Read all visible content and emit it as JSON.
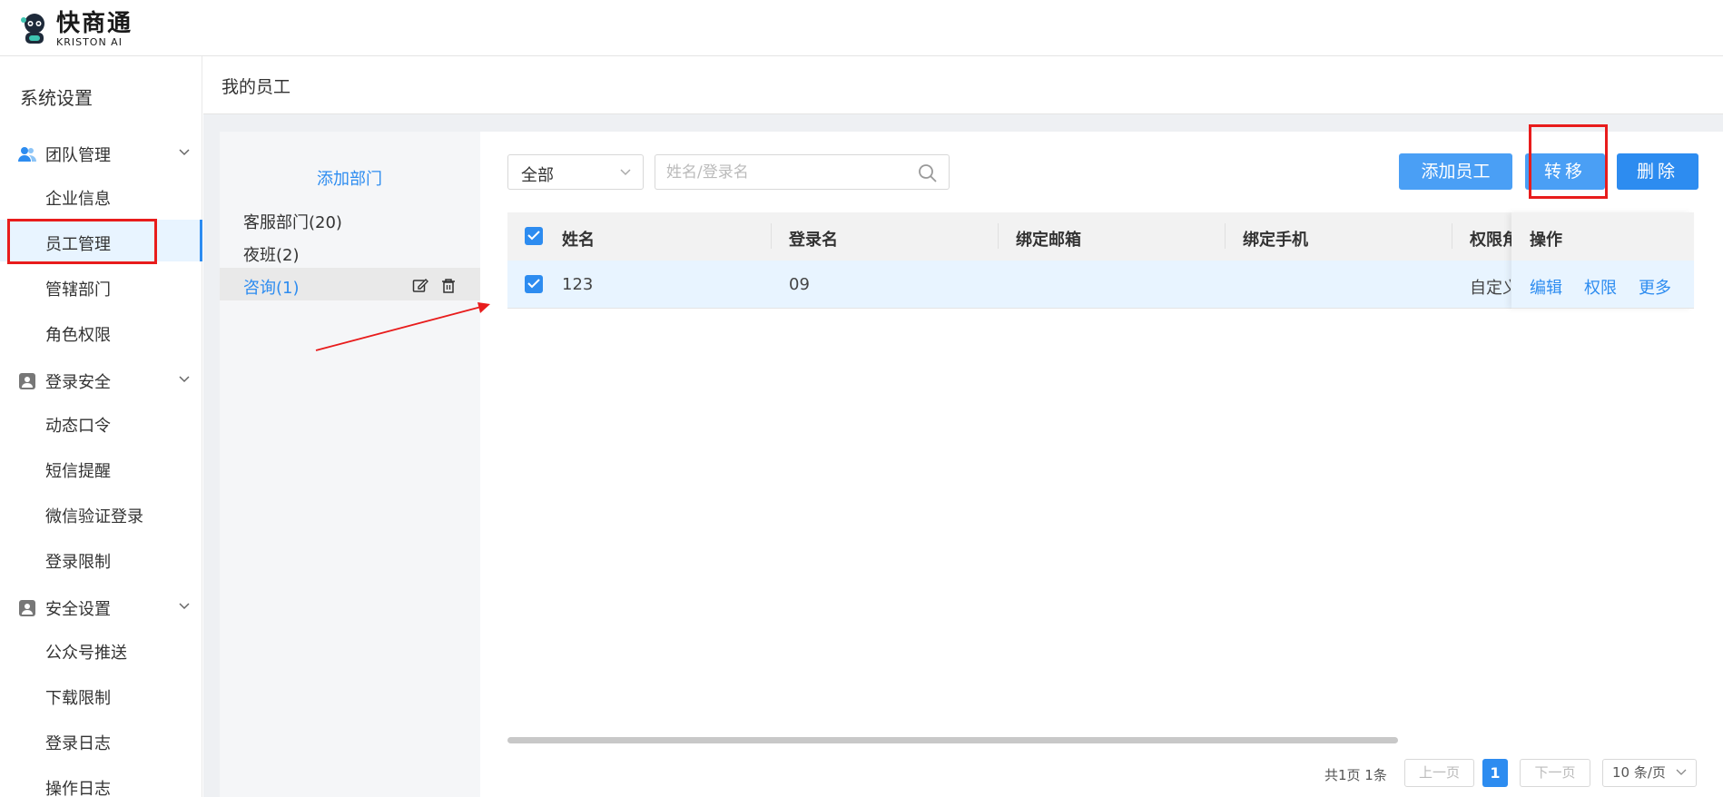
{
  "brand": {
    "name_cn": "快商通",
    "name_en": "KRISTON AI"
  },
  "sidebar": {
    "title": "系统设置",
    "groups": [
      {
        "label": "团队管理",
        "items": [
          "企业信息",
          "员工管理",
          "管辖部门",
          "角色权限"
        ]
      },
      {
        "label": "登录安全",
        "items": [
          "动态口令",
          "短信提醒",
          "微信验证登录",
          "登录限制"
        ]
      },
      {
        "label": "安全设置",
        "items": [
          "公众号推送",
          "下载限制",
          "登录日志",
          "操作日志"
        ]
      }
    ],
    "active_item": "员工管理"
  },
  "page": {
    "title": "我的员工"
  },
  "departments": {
    "add_label": "添加部门",
    "items": [
      "客服部门(20)",
      "夜班(2)",
      "咨询(1)"
    ],
    "selected": "咨询(1)"
  },
  "toolbar": {
    "filter_value": "全部",
    "search_placeholder": "姓名/登录名",
    "add_label": "添加员工",
    "move_label": "转移",
    "delete_label": "删除"
  },
  "table": {
    "headers": [
      "姓名",
      "登录名",
      "绑定邮箱",
      "绑定手机",
      "权限角",
      "操作"
    ],
    "rows": [
      {
        "name": "123",
        "login": "09",
        "email": "",
        "phone": "",
        "role": "自定义",
        "checked": true
      }
    ],
    "row_actions": [
      "编辑",
      "权限",
      "更多"
    ]
  },
  "pagination": {
    "total": "共1页 1条",
    "prev": "上一页",
    "current": "1",
    "next": "下一页",
    "page_size": "10 条/页"
  },
  "colors": {
    "accent": "#2d8cf0",
    "annotation": "#e81c1c",
    "selected_row": "#e8f4ff"
  }
}
